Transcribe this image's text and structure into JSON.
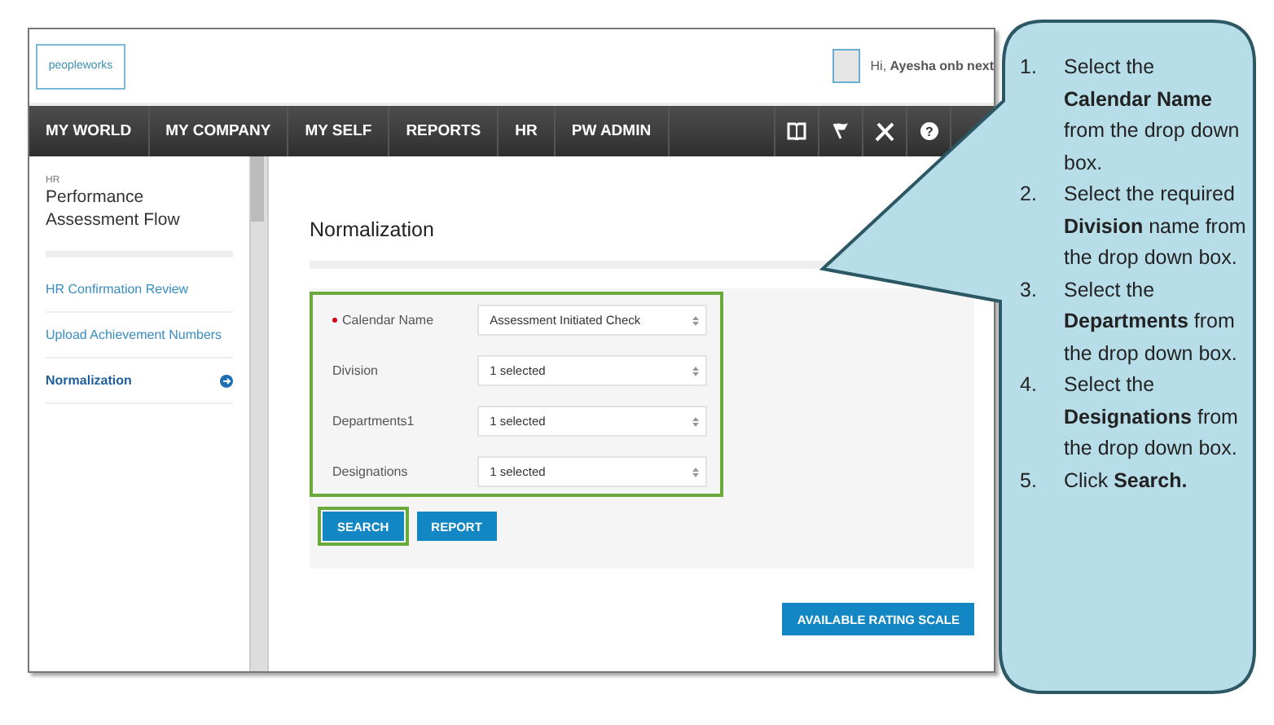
{
  "header": {
    "logo": "peopleworks",
    "greeting": "Hi, **Ayesha onb next**"
  },
  "nav": {
    "items": [
      "MY WORLD",
      "MY COMPANY",
      "MY SELF",
      "REPORTS",
      "HR",
      "PW ADMIN"
    ],
    "help_icon": "?"
  },
  "sidebar": {
    "section": "HR",
    "title": "Performance Assessment Flow",
    "items": [
      {
        "label": "HR Confirmation Review",
        "selected": false
      },
      {
        "label": "Upload Achievement Numbers",
        "selected": false
      },
      {
        "label": "Normalization",
        "selected": true
      }
    ]
  },
  "page": {
    "title": "Normalization",
    "highlighted": true,
    "fields": [
      {
        "label": "Calendar Name",
        "value": "Assessment Initiated Check",
        "required": true
      },
      {
        "label": "Division",
        "value": "1 selected",
        "required": false
      },
      {
        "label": "Departments1",
        "value": "1 selected",
        "required": false
      },
      {
        "label": "Designations",
        "value": "1 selected",
        "required": false
      }
    ],
    "buttons": [
      {
        "label": "SEARCH",
        "highlighted": true
      },
      {
        "label": "REPORT",
        "highlighted": false
      }
    ],
    "rating_button": "AVAILABLE RATING SCALE"
  },
  "callout": {
    "steps": [
      {
        "number": "1.",
        "text": "Select the **Calendar Name** from the drop down box."
      },
      {
        "number": "2.",
        "text": "Select the required **Division** name from the drop down box."
      },
      {
        "number": "3.",
        "text": "Select the **Departments** from the drop down box."
      },
      {
        "number": "4.",
        "text": "Select the **Designations** from the drop down box."
      },
      {
        "number": "5.",
        "text": "Click **Search.**"
      }
    ]
  }
}
